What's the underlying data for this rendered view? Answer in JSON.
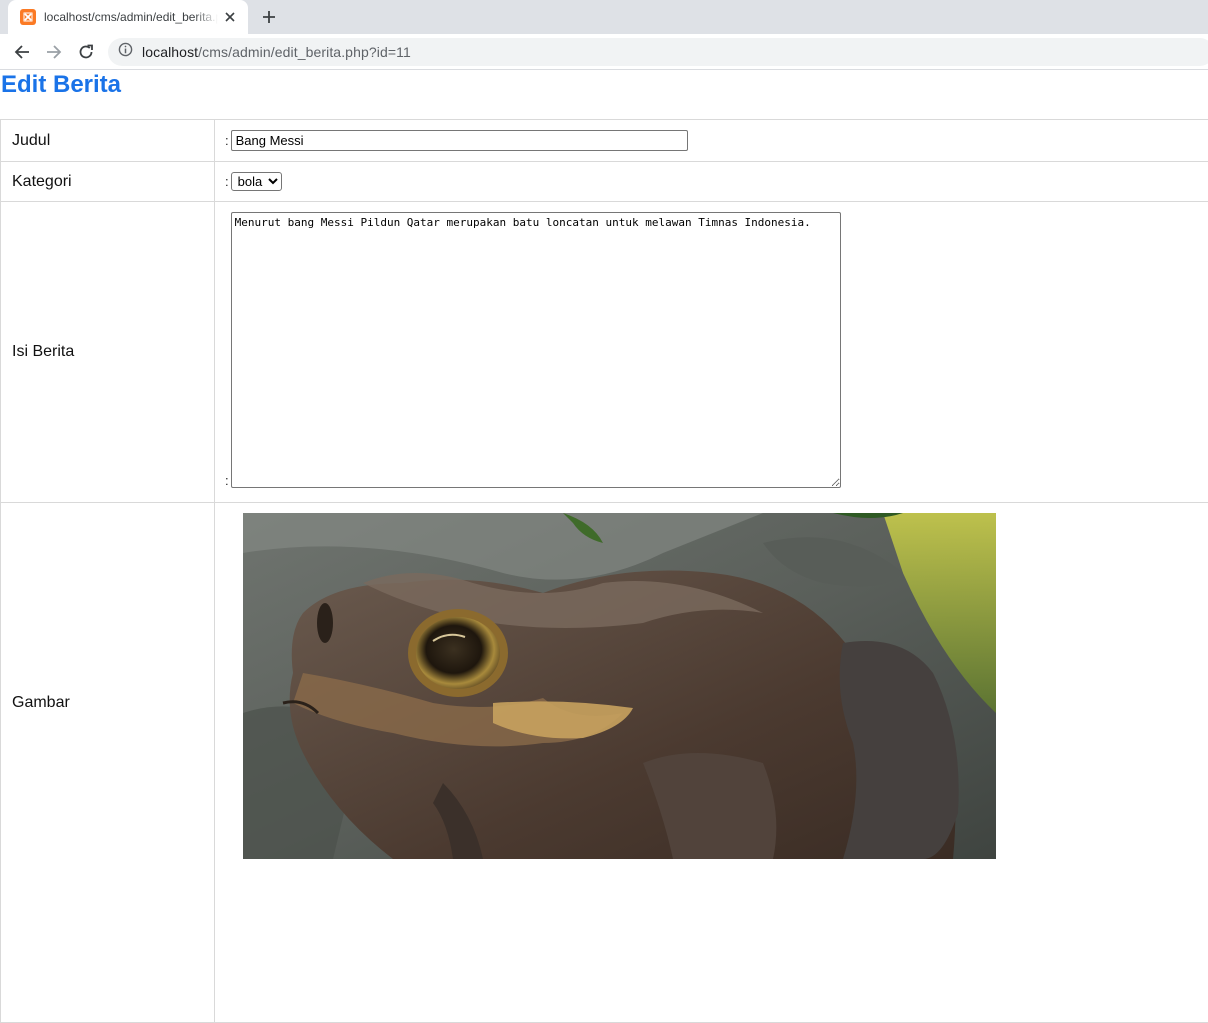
{
  "browser": {
    "tab_title": "localhost/cms/admin/edit_berita.php?id=11",
    "url_host": "localhost",
    "url_path": "/cms/admin/edit_berita.php?id=11"
  },
  "page": {
    "title": "Edit Berita"
  },
  "form": {
    "judul": {
      "label": "Judul",
      "value": "Bang Messi"
    },
    "kategori": {
      "label": "Kategori",
      "selected": "bola",
      "options": [
        "bola"
      ]
    },
    "isi": {
      "label": "Isi Berita",
      "value": "Menurut bang Messi Pildun Qatar merupakan batu loncatan untuk melawan Timnas Indonesia."
    },
    "gambar": {
      "label": "Gambar",
      "image_subject": "frog-photo"
    },
    "separator": ":"
  },
  "colors": {
    "title": "#1a73e8",
    "favicon": "#fb7a24",
    "table_border": "#d9d9d9"
  }
}
